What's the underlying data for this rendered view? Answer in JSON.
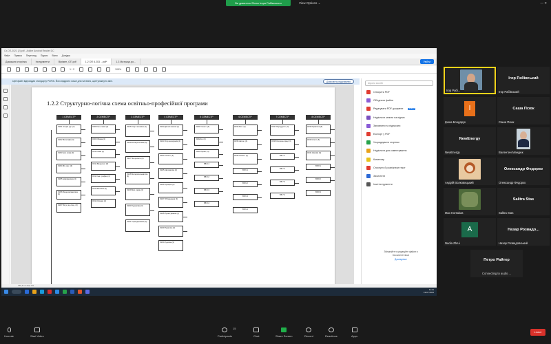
{
  "zoom_top": {
    "viewing_banner": "Ви дивитесь Ekran Ігоря Рабівського",
    "view_options": "View Options ⌄",
    "window_buttons": "— ✕"
  },
  "app": {
    "title": "Сх.ОП-2021 (2).pdf - Adobe Acrobat Reader DC",
    "menu": [
      "Файл",
      "Правка",
      "Перегляд",
      "Підпис",
      "Вікно",
      "Довідка"
    ],
    "tabs": [
      {
        "label": "Домашня сторінка",
        "active": false
      },
      {
        "label": "Інструменти",
        "active": false
      },
      {
        "label": "Вірімеп_ОП.pdf",
        "active": false
      },
      {
        "label": "1.2 ОП 6.203 ...pdf*",
        "active": true
      },
      {
        "label": "1.3 Матриця.ро...",
        "active": false
      }
    ],
    "sign_in": "Увійти",
    "toolbar": {
      "zoom": "105%",
      "page": "1 / 2"
    },
    "info_banner": "Цей файл відповідає стандарту PDF/A. Його відкрито лише для читання, щоб уникнути змін.",
    "info_banner_button": "Дозволити редагування",
    "statusbar": "296,8 x 210,8 мм"
  },
  "document": {
    "heading": "1.2.2 Структурно-логічна схема освітньо-професійної програми",
    "semesters": [
      "1 СЕМЕСТР",
      "2 СЕМЕСТР",
      "3 СЕМЕСТР",
      "4 СЕМЕСТР",
      "5 СЕМЕСТР",
      "6 СЕМЕСТР",
      "7 СЕМЕСТР",
      "8 СЕМЕСТР"
    ],
    "col1": [
      "ОК01 Історія укр. (3)",
      "ОК02 Філософія (3)",
      "ОК03 Іноз. мова (3)",
      "ОК04 Фіз. вих. (3)",
      "ОК05 Інформатика (4)",
      "ОК06 Вища математика (4)",
      "ОК07 Вступ до спец. (3)"
    ],
    "col2": [
      "ОК08 Іноз. мова (3)",
      "ОК09 Фізика (4)",
      "ОК10 Хімія (4)",
      "ОК11 Вища мат. (5)",
      "ОК12 Інж. графіка (4)",
      "ОК13 Безпека (3)",
      "ОК14 Основи (4)"
    ],
    "col3": [
      "ОК15 Теор. механіка (4)",
      "ОК16 Електротехніка (5)",
      "ОК17 Метрологія (4)",
      "ОК18 Матеріалознавство (4)",
      "ОК19 Мех. рідин (4)",
      "ОК20 Гідравліка (3)",
      "ОК21 Термодинаміка (4)"
    ],
    "col4": [
      "ОК22 Деталі машин (4)",
      "ОК23 Опір матеріалів (4)",
      "ОК24 Технол. (4)",
      "ОК25 Автоматика (4)",
      "ОК26 Процеси (4)",
      "ОК27 Обладнання (4)",
      "ОК28 Проєктування (4)",
      "ОК29 Практика (3)",
      "ОК30 Курсова (3)"
    ],
    "col5": [
      "ОК31 Технол. (4)",
      "ОК32 Ек. (4)",
      "ОК33 Проєкт (4)",
      "ВБ 5.1",
      "ВБ 5.2",
      "ВБ 5.3",
      "ВБ 5.4"
    ],
    "col6": [
      "ОК34 Мех. (4)",
      "ОК35 Автом. (4)",
      "ОК36 Технол. (4)",
      "ВБ 6.1",
      "ВБ 6.2",
      "ВБ 6.3",
      "ВБ 6.4"
    ],
    "col7": [
      "ОК37 Переддипл. (4)",
      "ОК38 Охорона праці (3)",
      "ВБ 7.1",
      "ВБ 7.2",
      "ВБ 7.3",
      "ВБ 7.4"
    ],
    "col8": [
      "ОК39 Практика (5)",
      "ОК40 Атест. (6)",
      "ОК41 Кваліф. (6)",
      "ВБ 8.1",
      "ВБ 8.2",
      "ВБ 8.3"
    ]
  },
  "right_panel": {
    "search_placeholder": "Шукати засоби",
    "items": [
      {
        "label": "Створити PDF",
        "color": "#e03c31"
      },
      {
        "label": "Об'єднати файли",
        "color": "#8a5cd6"
      },
      {
        "label": "Редагувати PDF документ",
        "color": "#e03c31"
      },
      {
        "label": "Надіслати запити на підпис",
        "color": "#7a4fbf"
      },
      {
        "label": "Заповнити та підписати",
        "color": "#8a5cd6"
      },
      {
        "label": "Експорт у PDF",
        "color": "#e03c31"
      },
      {
        "label": "Упорядкувати сторінки",
        "color": "#27a24a"
      },
      {
        "label": "Надіслати для коментування",
        "color": "#e8a21a"
      },
      {
        "label": "Коментар",
        "color": "#e8c21a"
      },
      {
        "label": "Стиснути й розпізнати текст",
        "color": "#e03c31"
      },
      {
        "label": "Захистити",
        "color": "#2d6ad6"
      },
      {
        "label": "Інші інструменти",
        "color": "#555555"
      }
    ],
    "new_badge": "НОВИЙ",
    "footer_line1": "Зберігайте та редагуйте файли в",
    "footer_line2": "Document Cloud",
    "footer_link": "Докладніше"
  },
  "taskbar": {
    "time": "11:21",
    "date": "19.07.2021"
  },
  "participants": [
    {
      "name": "Ігор Рабі...",
      "kind": "video"
    },
    {
      "name": "Ігор Рабівський",
      "kind": "name"
    },
    {
      "name": "Ірина Бондарук",
      "kind": "avatar",
      "letter": "I",
      "color": "#e8701a"
    },
    {
      "name": "Саша Псюк",
      "kind": "name"
    },
    {
      "name": "NewEnergy",
      "kind": "name"
    },
    {
      "name": "Валентин Мандюк",
      "kind": "photo"
    },
    {
      "name": "Андрій Волковицький",
      "kind": "photo"
    },
    {
      "name": "Олександр Федорко",
      "kind": "name"
    },
    {
      "name": "Max Korsakas",
      "kind": "photo"
    },
    {
      "name": "Salitra Stas",
      "kind": "name"
    },
    {
      "name": "Nadia Zbrui",
      "kind": "avatar",
      "letter": "A",
      "color": "#1a6a4a"
    },
    {
      "name": "Назар Розвадовський",
      "kind": "name"
    },
    {
      "name": "Петро Райтер",
      "kind": "status",
      "status": "Connecting to audio ..."
    }
  ],
  "participant_tile_titles": {
    "rabivskyi": "Ігор Рабівський",
    "psiuk": "Саша Псюк",
    "newenergy": "NewEnergy",
    "fedorko": "Олександр Федорко",
    "salitra": "Salitra Stas",
    "rozvadovskyi": "Назар Розвадо...",
    "raiter": "Петро Райтер"
  },
  "controls": {
    "unmute": "Unmute",
    "start_video": "Start Video",
    "participants": "Participants",
    "participants_count": "15",
    "chat": "Chat",
    "share_screen": "Share Screen",
    "record": "Record",
    "reactions": "Reactions",
    "apps": "Apps",
    "end": "Leave"
  }
}
